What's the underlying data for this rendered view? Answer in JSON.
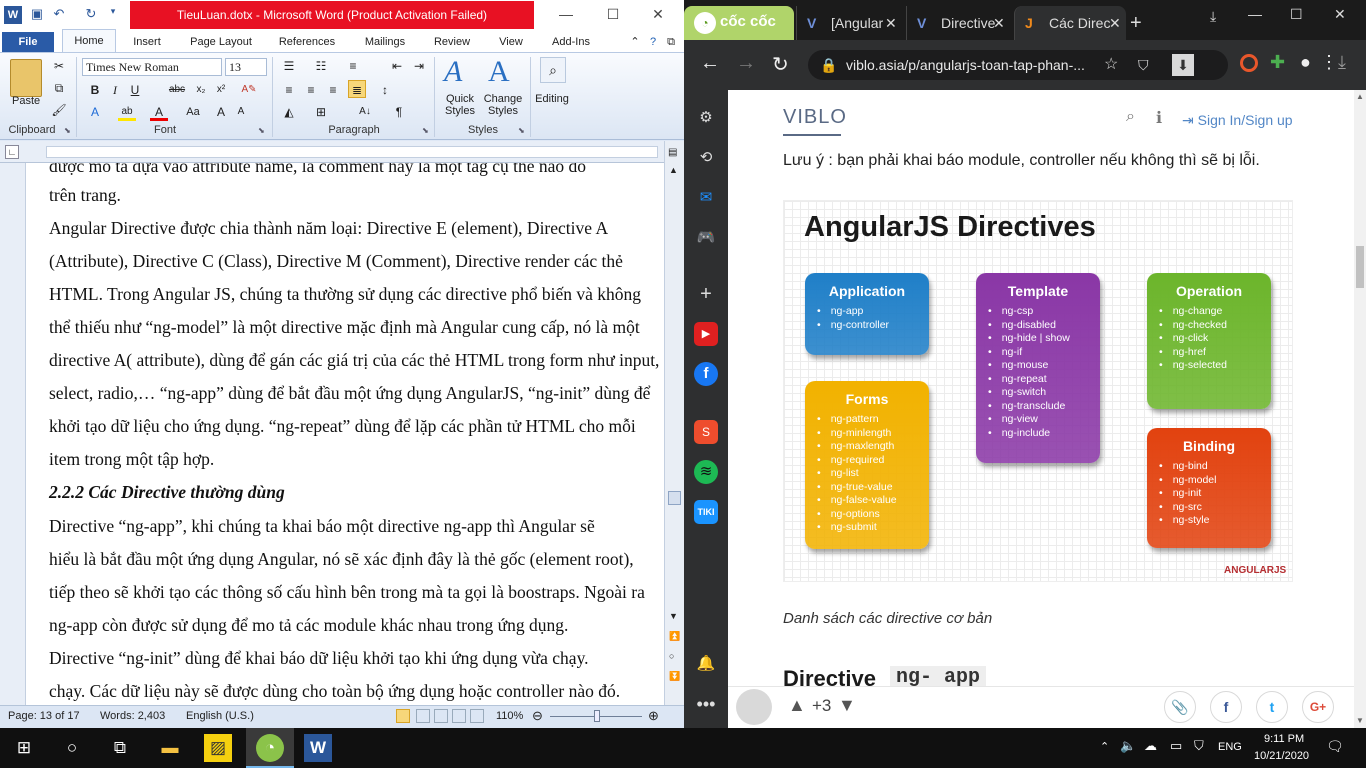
{
  "word": {
    "title": "TieuLuan.dotx - Microsoft Word (Product Activation Failed)",
    "tabs": [
      "File",
      "Home",
      "Insert",
      "Page Layout",
      "References",
      "Mailings",
      "Review",
      "View",
      "Add-Ins"
    ],
    "clipboard": {
      "paste": "Paste",
      "label": "Clipboard"
    },
    "font": {
      "name": "Times New Roman",
      "size": "13",
      "label": "Font"
    },
    "paragraph_label": "Paragraph",
    "styles": {
      "quick": "Quick\nStyles",
      "change": "Change\nStyles",
      "label": "Styles"
    },
    "editing": "Editing",
    "doc_lines": [
      "được mô tả dựa vào attribute name, là comment hay là một tag cụ thể nào đó",
      "trên trang.",
      "        Angular Directive được chia thành năm loại: Directive E (element), Directive A",
      "(Attribute), Directive C (Class), Directive M (Comment), Directive render các thẻ",
      "HTML. Trong Angular JS, chúng ta thường sử dụng các directive phổ biến và không",
      "thể thiếu như “ng-model” là một directive mặc định mà Angular cung cấp, nó là một",
      "directive A( attribute), dùng để gán các giá trị của các thẻ HTML trong form như input,",
      "select, radio,… “ng-app” dùng để bắt đầu một ứng dụng AngularJS, “ng-init” dùng để",
      "khởi tạo dữ liệu cho ứng dụng. “ng-repeat” dùng để lặp các phần tử HTML cho mỗi",
      "item trong một tập hợp."
    ],
    "heading": "2.2.2 Các Directive thường dùng",
    "doc_lines2": [
      "        Directive “ng-app”, khi chúng ta khai báo một directive ng-app thì Angular sẽ",
      "hiểu là bắt đầu một ứng dụng Angular, nó sẽ xác định đây là thẻ gốc (element root),",
      "tiếp theo sẽ khởi tạo các thông số cấu hình bên trong mà ta gọi là boostraps. Ngoài ra",
      "ng-app còn được sử dụng để mo tả các module khác nhau trong ứng dụng.",
      "        Directive “ng-init” dùng để khai báo dữ liệu khởi tạo khi ứng dụng vừa chạy.",
      "chạy. Các dữ liệu này sẽ được dùng cho toàn bộ ứng dụng hoặc controller nào đó."
    ],
    "status": {
      "page": "Page: 13 of 17",
      "words": "Words: 2,403",
      "lang": "English (U.S.)",
      "zoom": "110%"
    }
  },
  "browser": {
    "tabs": [
      {
        "label": "[Angular"
      },
      {
        "label": "Directive"
      },
      {
        "label": "Các Direc"
      }
    ],
    "brand": "cốc cốc",
    "url": "viblo.asia/p/angularjs-toan-tap-phan-...",
    "site_logo": "VIBLO",
    "signin": "Sign In/Sign up",
    "note": "Lưu ý : bạn phải khai báo module, controller nếu không thì sẽ bị lỗi.",
    "caption": "Danh sách các directive cơ bản",
    "next_heading": "Directive",
    "next_code": "ng- app",
    "votes": "+3"
  },
  "diagram": {
    "title": "AngularJS Directives",
    "cards": [
      {
        "name": "Application",
        "items": [
          "ng-app",
          "ng-controller"
        ],
        "color": "#1f7fc8"
      },
      {
        "name": "Forms",
        "items": [
          "ng-pattern",
          "ng-minlength",
          "ng-maxlength",
          "ng-required",
          "ng-list",
          "ng-true-value",
          "ng-false-value",
          "ng-options",
          "ng-submit"
        ],
        "color": "#f2b200"
      },
      {
        "name": "Template",
        "items": [
          "ng-csp",
          "ng-disabled",
          "ng-hide | show",
          "ng-if",
          "ng-mouse",
          "ng-repeat",
          "ng-switch",
          "ng-transclude",
          "ng-view",
          "ng-include"
        ],
        "color": "#8a37a6"
      },
      {
        "name": "Operation",
        "items": [
          "ng-change",
          "ng-checked",
          "ng-click",
          "ng-href",
          "ng-selected"
        ],
        "color": "#6cb52b"
      },
      {
        "name": "Binding",
        "items": [
          "ng-bind",
          "ng-model",
          "ng-init",
          "ng-src",
          "ng-style"
        ],
        "color": "#e2420f"
      }
    ],
    "logo": "ANGULARJS"
  },
  "taskbar": {
    "lang": "ENG",
    "time": "9:11 PM",
    "date": "10/21/2020"
  }
}
